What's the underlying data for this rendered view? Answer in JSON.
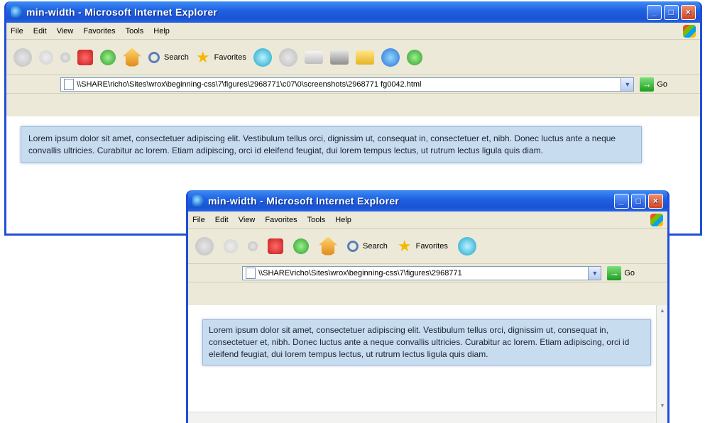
{
  "window1": {
    "title": "min-width - Microsoft Internet Explorer",
    "menu": [
      "File",
      "Edit",
      "View",
      "Favorites",
      "Tools",
      "Help"
    ],
    "toolbar": {
      "search_label": "Search",
      "favorites_label": "Favorites"
    },
    "address": {
      "url": "\\\\SHARE\\richo\\Sites\\wrox\\beginning-css\\7\\figures\\2968771\\c07\\0\\screenshots\\2968771 fg0042.html",
      "go_label": "Go"
    },
    "body_text": "Lorem ipsum dolor sit amet, consectetuer adipiscing elit. Vestibulum tellus orci, dignissim ut, consequat in, consectetuer et, nibh. Donec luctus ante a neque convallis ultricies. Curabitur ac lorem. Etiam adipiscing, orci id eleifend feugiat, dui lorem tempus lectus, ut rutrum lectus ligula quis diam."
  },
  "window2": {
    "title": "min-width - Microsoft Internet Explorer",
    "menu": [
      "File",
      "Edit",
      "View",
      "Favorites",
      "Tools",
      "Help"
    ],
    "toolbar": {
      "search_label": "Search",
      "favorites_label": "Favorites"
    },
    "address": {
      "url": "\\\\SHARE\\richo\\Sites\\wrox\\beginning-css\\7\\figures\\2968771",
      "go_label": "Go"
    },
    "body_text": "Lorem ipsum dolor sit amet, consectetuer adipiscing elit. Vestibulum tellus orci, dignissim ut, consequat in, consectetuer et, nibh. Donec luctus ante a neque convallis ultricies. Curabitur ac lorem. Etiam adipiscing, orci id eleifend feugiat, dui lorem tempus lectus, ut rutrum lectus ligula quis diam."
  },
  "colors": {
    "titlebar": "#1e5fe0",
    "chrome": "#ece9d8",
    "text_block_bg": "#c8dcf0"
  }
}
